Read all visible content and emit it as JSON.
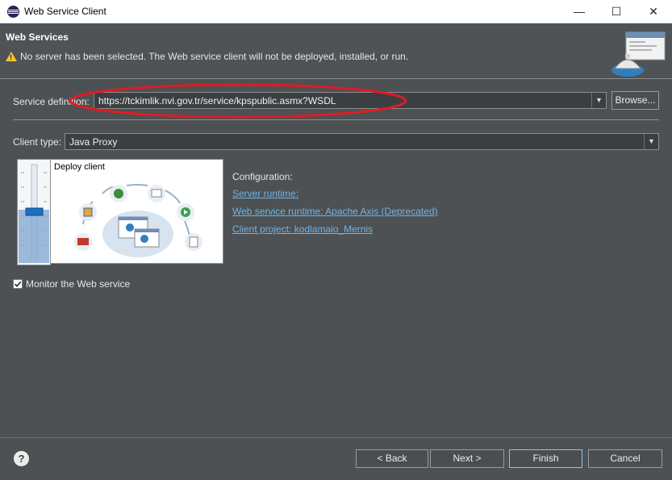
{
  "window": {
    "title": "Web Service Client",
    "controls": {
      "minimize": "—",
      "maximize": "☐",
      "close": "✕"
    }
  },
  "banner": {
    "title": "Web Services",
    "message": "No server has been selected. The Web service client will not be deployed, installed, or run."
  },
  "service_definition": {
    "label": "Service definition:",
    "value": "https://tckimlik.nvi.gov.tr/service/kpspublic.asmx?WSDL",
    "browse_label": "Browse..."
  },
  "client_type": {
    "label": "Client type:",
    "value": "Java Proxy"
  },
  "deploy_panel": {
    "title": "Deploy client",
    "slider_level": 0.5
  },
  "configuration": {
    "title": "Configuration:",
    "server_runtime": "Server runtime: ",
    "web_service_runtime": "Web service runtime: Apache Axis (Deprecated)",
    "client_project": "Client project: kodlamaio_Mernis"
  },
  "monitor": {
    "label": "Monitor the Web service",
    "checked": true
  },
  "footer": {
    "help": "?",
    "back_label": "< Back",
    "next_label": "Next >",
    "finish_label": "Finish",
    "cancel_label": "Cancel"
  },
  "colors": {
    "accent_link": "#6fb3e8",
    "annotation_red": "#e01b24",
    "background": "#4d5153"
  }
}
